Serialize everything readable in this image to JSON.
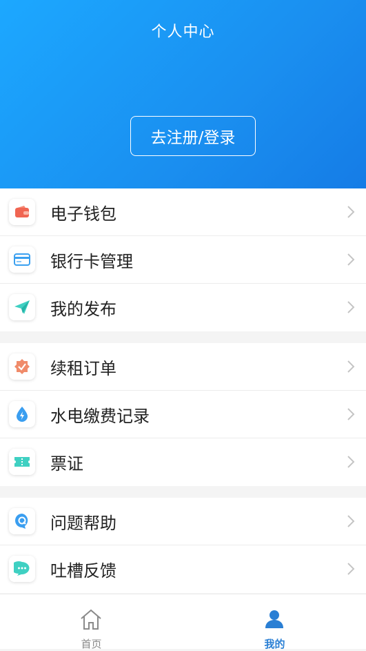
{
  "header": {
    "title": "个人中心",
    "login_label": "去注册/登录"
  },
  "group1": [
    {
      "label": "电子钱包",
      "icon": "wallet-icon"
    },
    {
      "label": "银行卡管理",
      "icon": "bank-card-icon"
    },
    {
      "label": "我的发布",
      "icon": "paper-plane-icon"
    }
  ],
  "group2": [
    {
      "label": "续租订单",
      "icon": "badge-check-icon"
    },
    {
      "label": "水电缴费记录",
      "icon": "water-drop-bolt-icon"
    },
    {
      "label": "票证",
      "icon": "ticket-icon"
    }
  ],
  "group3": [
    {
      "label": "问题帮助",
      "icon": "help-q-icon"
    },
    {
      "label": "吐槽反馈",
      "icon": "chat-bubble-icon"
    }
  ],
  "tabbar": {
    "home_label": "首页",
    "mine_label": "我的",
    "active": "mine",
    "colors": {
      "active": "#2a7fd4",
      "inactive": "#888888"
    }
  }
}
